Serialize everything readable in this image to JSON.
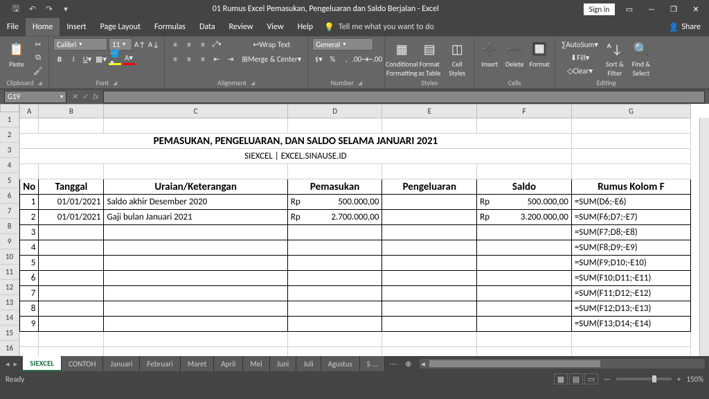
{
  "titlebar": {
    "doc": "01 Rumus Excel Pemasukan, Pengeluaran dan Saldo Berjalan  -  Excel",
    "signin": "Sign in"
  },
  "menu": {
    "file": "File",
    "home": "Home",
    "insert": "Insert",
    "page": "Page Layout",
    "formulas": "Formulas",
    "data": "Data",
    "review": "Review",
    "view": "View",
    "help": "Help",
    "tellme": "Tell me what you want to do",
    "share": "Share"
  },
  "ribbon": {
    "clipboard": {
      "label": "Clipboard",
      "paste": "Paste"
    },
    "font": {
      "label": "Font",
      "name": "Calibri",
      "size": "11"
    },
    "alignment": {
      "label": "Alignment",
      "wrap": "Wrap Text",
      "merge": "Merge & Center"
    },
    "number": {
      "label": "Number",
      "format": "General"
    },
    "styles": {
      "label": "Styles",
      "cond": "Conditional Formatting",
      "fat": "Format as Table",
      "cell": "Cell Styles"
    },
    "cells": {
      "label": "Cells",
      "ins": "Insert",
      "del": "Delete",
      "fmt": "Format"
    },
    "editing": {
      "label": "Editing",
      "sum": "AutoSum",
      "fill": "Fill",
      "clear": "Clear",
      "sort": "Sort & Filter",
      "find": "Find & Select"
    }
  },
  "namebox": "G19",
  "colHeaders": [
    "A",
    "B",
    "C",
    "D",
    "E",
    "F",
    "G"
  ],
  "rowHeaders": [
    "1",
    "2",
    "3",
    "4",
    "5",
    "6",
    "7",
    "8",
    "9",
    "10",
    "11",
    "12",
    "13",
    "14",
    "15",
    "16"
  ],
  "title1": "PEMASUKAN, PENGELUARAN, DAN SALDO SELAMA JANUARI 2021",
  "title2": "SIEXCEL | EXCEL.SINAUSE.ID",
  "hdr": {
    "A": "No",
    "B": "Tanggal",
    "C": "Uraian/Keterangan",
    "D": "Pemasukan",
    "E": "Pengeluaran",
    "F": "Saldo",
    "G": "Rumus Kolom F"
  },
  "rows": [
    {
      "blue": false,
      "A": "1",
      "B": "01/01/2021",
      "C": "Saldo akhir Desember 2020",
      "D": "500.000,00",
      "E": "",
      "F": "500.000,00",
      "G": "=SUM(D6;-E6)"
    },
    {
      "blue": true,
      "A": "2",
      "B": "01/01/2021",
      "C": "Gaji bulan Januari 2021",
      "D": "2.700.000,00",
      "E": "",
      "F": "3.200.000,00",
      "G": "=SUM(F6;D7;-E7)"
    },
    {
      "blue": false,
      "A": "3",
      "B": "",
      "C": "",
      "D": "",
      "E": "",
      "F": "",
      "G": "=SUM(F7;D8;-E8)"
    },
    {
      "blue": true,
      "A": "4",
      "B": "",
      "C": "",
      "D": "",
      "E": "",
      "F": "",
      "G": "=SUM(F8;D9;-E9)"
    },
    {
      "blue": false,
      "A": "5",
      "B": "",
      "C": "",
      "D": "",
      "E": "",
      "F": "",
      "G": "=SUM(F9;D10;-E10)"
    },
    {
      "blue": true,
      "A": "6",
      "B": "",
      "C": "",
      "D": "",
      "E": "",
      "F": "",
      "G": "=SUM(F10;D11;-E11)"
    },
    {
      "blue": false,
      "A": "7",
      "B": "",
      "C": "",
      "D": "",
      "E": "",
      "F": "",
      "G": "=SUM(F11;D12;-E12)"
    },
    {
      "blue": true,
      "A": "8",
      "B": "",
      "C": "",
      "D": "",
      "E": "",
      "F": "",
      "G": "=SUM(F12;D13;-E13)"
    },
    {
      "blue": false,
      "A": "9",
      "B": "",
      "C": "",
      "D": "",
      "E": "",
      "F": "",
      "G": "=SUM(F13;D14;-E14)"
    }
  ],
  "tabs": [
    "SIEXCEL",
    "CONTOH",
    "Januari",
    "Februari",
    "Maret",
    "April",
    "Mei",
    "Juni",
    "Juli",
    "Agustus",
    "S …"
  ],
  "status": {
    "ready": "Ready",
    "zoom": "150%"
  }
}
